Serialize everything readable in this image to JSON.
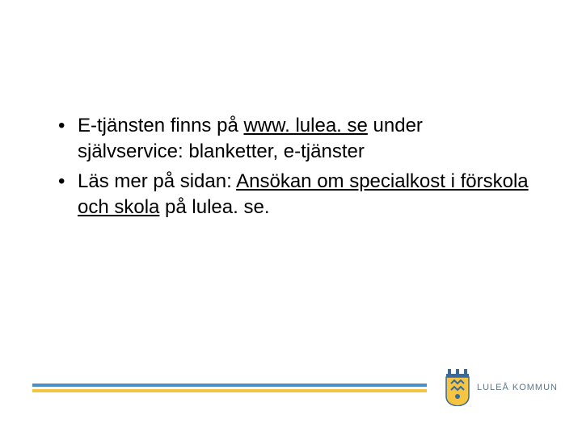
{
  "bullets": [
    {
      "pre": "E-tjänsten finns på ",
      "link": "www. lulea. se",
      "post": " under självservice: blanketter, e-tjänster"
    },
    {
      "pre": "Läs mer på sidan: ",
      "link": "Ansökan om specialkost i förskola och skola",
      "post": " på lulea. se."
    }
  ],
  "footer": {
    "org": "LULEÅ KOMMUN"
  }
}
